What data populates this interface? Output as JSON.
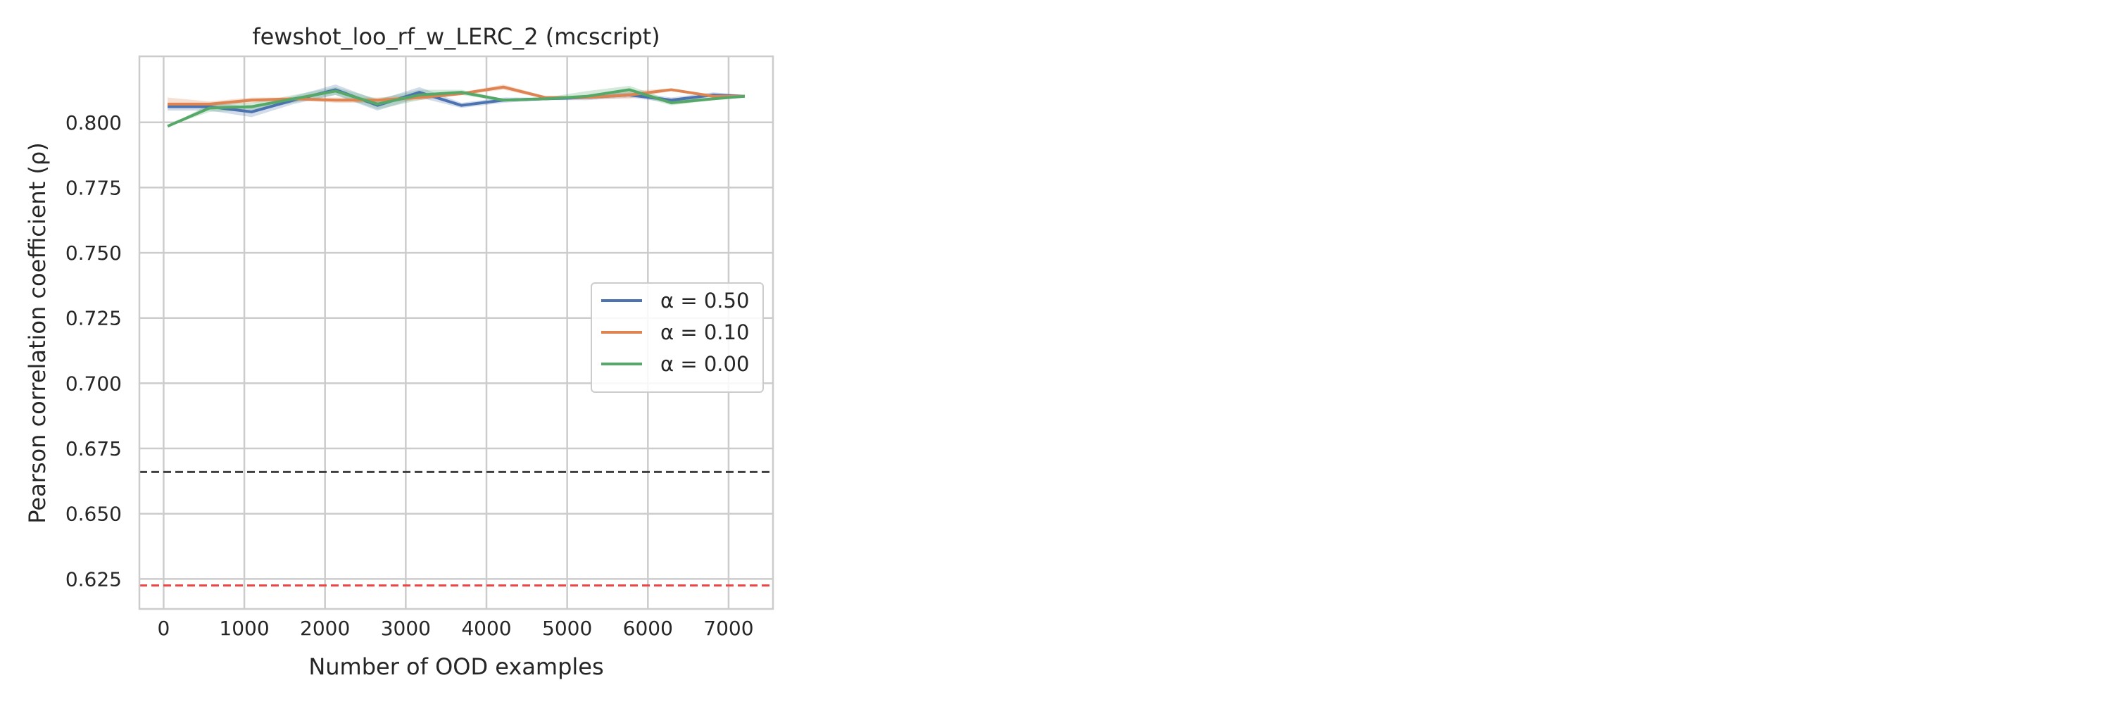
{
  "chart_data": {
    "type": "line",
    "title": "fewshot_loo_rf_w_LERC_2 (mcscript)",
    "xlabel": "Number of OOD examples",
    "ylabel": "Pearson correlation coefficient (ρ)",
    "xlim": [
      -300,
      7550
    ],
    "ylim": [
      0.6135,
      0.8253
    ],
    "xticks": [
      0,
      1000,
      2000,
      3000,
      4000,
      5000,
      6000,
      7000
    ],
    "xtick_labels": [
      "0",
      "1000",
      "2000",
      "3000",
      "4000",
      "5000",
      "6000",
      "7000"
    ],
    "yticks": [
      0.625,
      0.65,
      0.675,
      0.7,
      0.725,
      0.75,
      0.775,
      0.8
    ],
    "ytick_labels": [
      "0.625",
      "0.650",
      "0.675",
      "0.700",
      "0.725",
      "0.750",
      "0.775",
      "0.800"
    ],
    "grid": true,
    "legend_position": "center-right",
    "x": [
      50,
      570,
      1090,
      1610,
      2130,
      2650,
      3170,
      3690,
      4210,
      4730,
      5250,
      5770,
      6290,
      6810,
      7200
    ],
    "series": [
      {
        "name": "α = 0.50",
        "color": "#4c72b0",
        "values": [
          0.806,
          0.806,
          0.804,
          0.8085,
          0.8125,
          0.8065,
          0.8115,
          0.8065,
          0.8085,
          0.809,
          0.8095,
          0.8105,
          0.8085,
          0.8105,
          0.81
        ],
        "band_low": [
          0.8045,
          0.8045,
          0.802,
          0.807,
          0.8105,
          0.8045,
          0.8095,
          0.8055,
          0.8075,
          0.8085,
          0.8085,
          0.8095,
          0.8075,
          0.8095,
          0.8095
        ],
        "band_high": [
          0.8075,
          0.8075,
          0.806,
          0.81,
          0.8145,
          0.8085,
          0.8135,
          0.8075,
          0.8095,
          0.8095,
          0.8105,
          0.8115,
          0.8095,
          0.8115,
          0.8105
        ]
      },
      {
        "name": "α = 0.10",
        "color": "#dd8452",
        "values": [
          0.807,
          0.807,
          0.8085,
          0.809,
          0.8085,
          0.8085,
          0.8095,
          0.811,
          0.8135,
          0.8095,
          0.8095,
          0.8105,
          0.8125,
          0.81,
          0.81
        ],
        "band_low": [
          0.8055,
          0.806,
          0.8075,
          0.8085,
          0.8075,
          0.8075,
          0.8085,
          0.8105,
          0.8125,
          0.809,
          0.809,
          0.809,
          0.812,
          0.8095,
          0.8095
        ],
        "band_high": [
          0.8095,
          0.808,
          0.8095,
          0.8095,
          0.8095,
          0.8095,
          0.8105,
          0.8115,
          0.8145,
          0.81,
          0.81,
          0.812,
          0.813,
          0.8105,
          0.8105
        ]
      },
      {
        "name": "α = 0.00",
        "color": "#55a868",
        "values": [
          0.7985,
          0.8055,
          0.806,
          0.809,
          0.812,
          0.807,
          0.8105,
          0.8115,
          0.8085,
          0.809,
          0.81,
          0.8125,
          0.8075,
          0.809,
          0.81
        ],
        "band_low": [
          0.7985,
          0.804,
          0.8045,
          0.8075,
          0.8105,
          0.805,
          0.8085,
          0.8105,
          0.808,
          0.8085,
          0.809,
          0.811,
          0.8065,
          0.8085,
          0.8095
        ],
        "band_high": [
          0.7985,
          0.807,
          0.8075,
          0.8105,
          0.8135,
          0.809,
          0.8125,
          0.8125,
          0.809,
          0.8095,
          0.812,
          0.814,
          0.8085,
          0.8095,
          0.8105
        ]
      }
    ],
    "reference_lines": [
      {
        "y": 0.666,
        "color": "#404040",
        "style": "dashed"
      },
      {
        "y": 0.6225,
        "color": "#ee4444",
        "style": "dashed"
      }
    ]
  }
}
